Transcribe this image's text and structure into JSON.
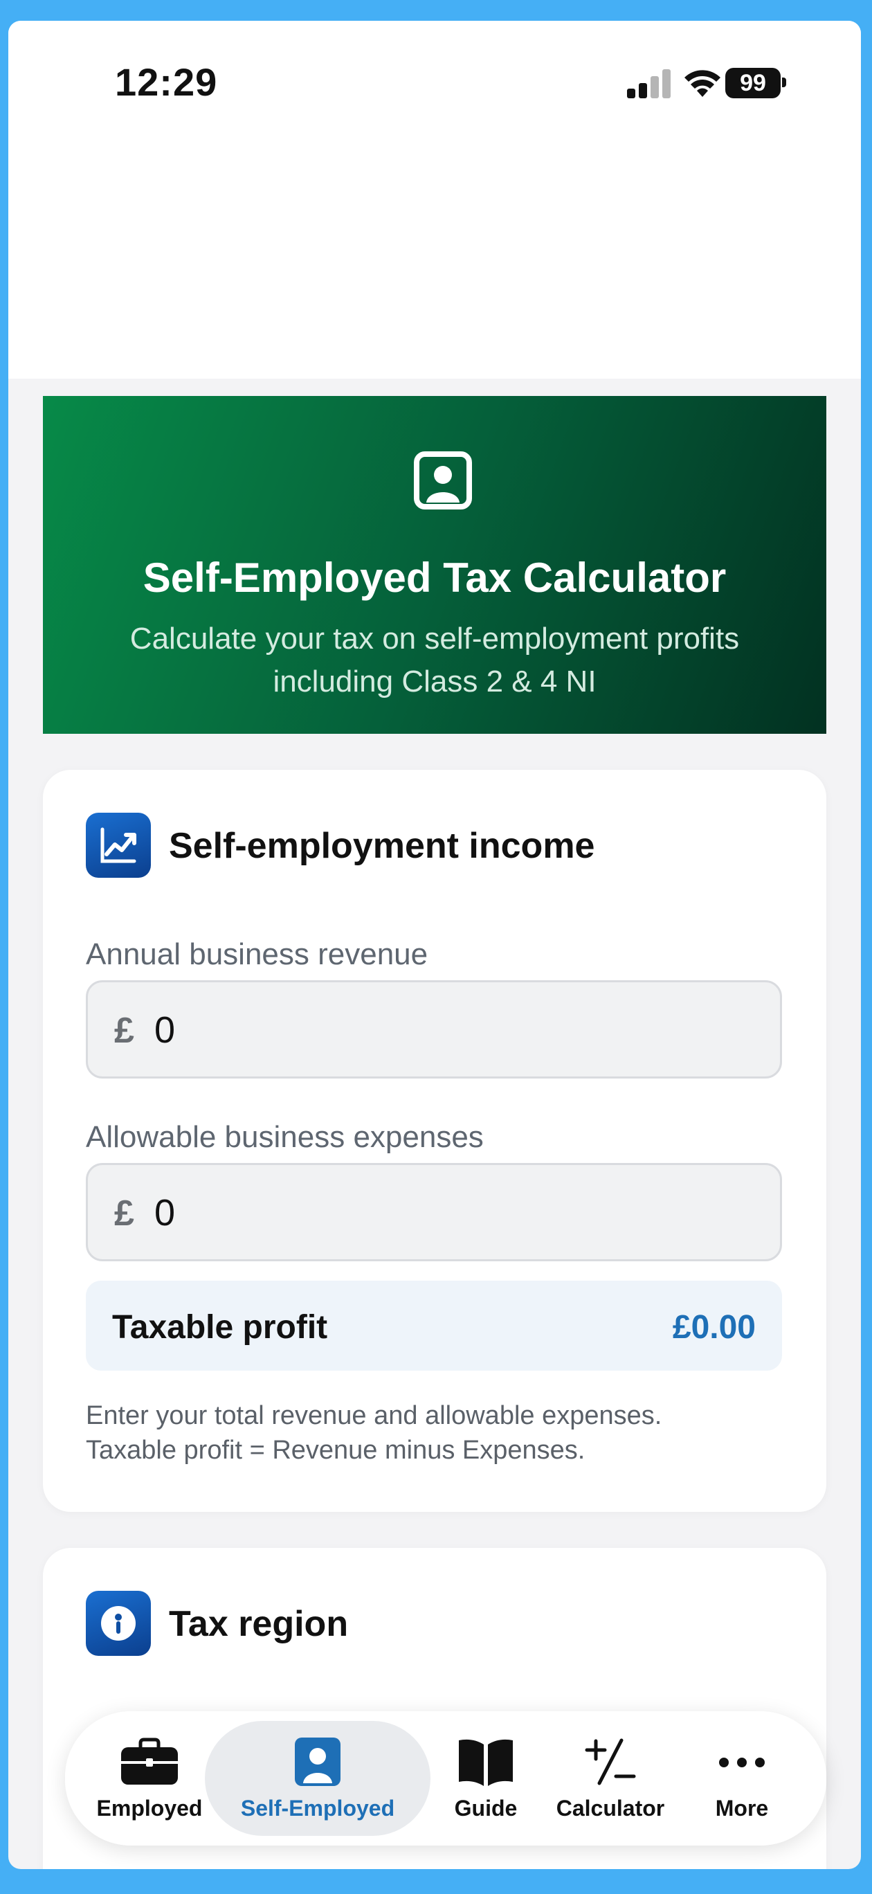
{
  "status_bar": {
    "time": "12:29",
    "battery": "99"
  },
  "hero": {
    "icon": "person-badge-icon",
    "title": "Self-Employed Tax Calculator",
    "subtitle": "Calculate your tax on self-employment profits including Class 2 & 4 NI"
  },
  "income_card": {
    "icon": "chart-line-icon",
    "title": "Self-employment income",
    "revenue": {
      "label": "Annual business revenue",
      "currency": "£",
      "value": "0"
    },
    "expenses": {
      "label": "Allowable business expenses",
      "currency": "£",
      "value": "0"
    },
    "profit": {
      "label": "Taxable profit",
      "value": "£0.00"
    },
    "help_line1": "Enter your total revenue and allowable expenses.",
    "help_line2": "Taxable profit = Revenue minus Expenses."
  },
  "region_card": {
    "icon": "info-key-icon",
    "title": "Tax region"
  },
  "tabbar": {
    "tabs": [
      {
        "label": "Employed",
        "icon": "briefcase-icon"
      },
      {
        "label": "Self-Employed",
        "icon": "person-badge-icon",
        "active": true
      },
      {
        "label": "Guide",
        "icon": "book-icon"
      },
      {
        "label": "Calculator",
        "icon": "plus-minus-icon"
      },
      {
        "label": "More",
        "icon": "ellipsis-icon"
      }
    ]
  },
  "colors": {
    "accent": "#1e6fb6",
    "hero_start": "#078a48",
    "hero_end": "#023121",
    "frame": "#45aff5"
  }
}
